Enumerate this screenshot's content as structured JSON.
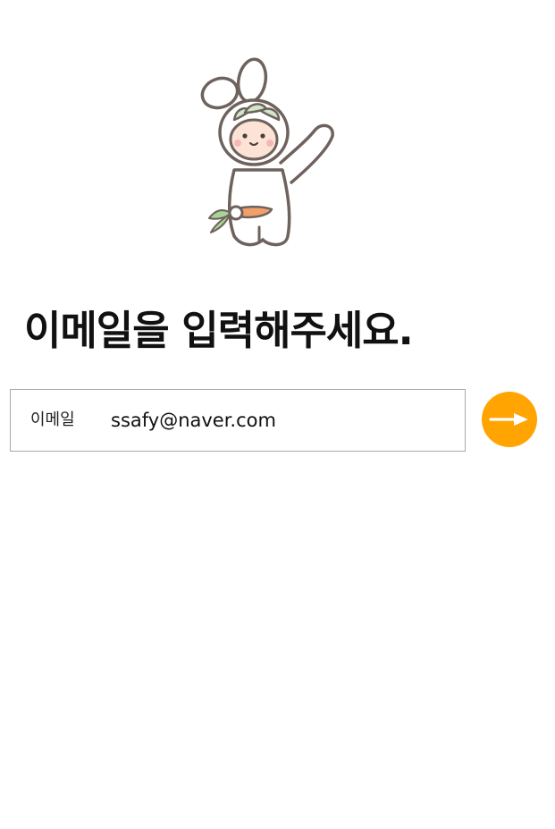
{
  "mascot": {
    "icon": "bunny-carrot-mascot-icon"
  },
  "header": {
    "title": "이메일을 입력해주세요."
  },
  "form": {
    "email_label": "이메일",
    "email_value": "ssafy@naver.com",
    "next_icon": "arrow-right-icon"
  },
  "colors": {
    "accent": "#ffa400",
    "input_border": "#a9a9a9",
    "text": "#111111"
  }
}
